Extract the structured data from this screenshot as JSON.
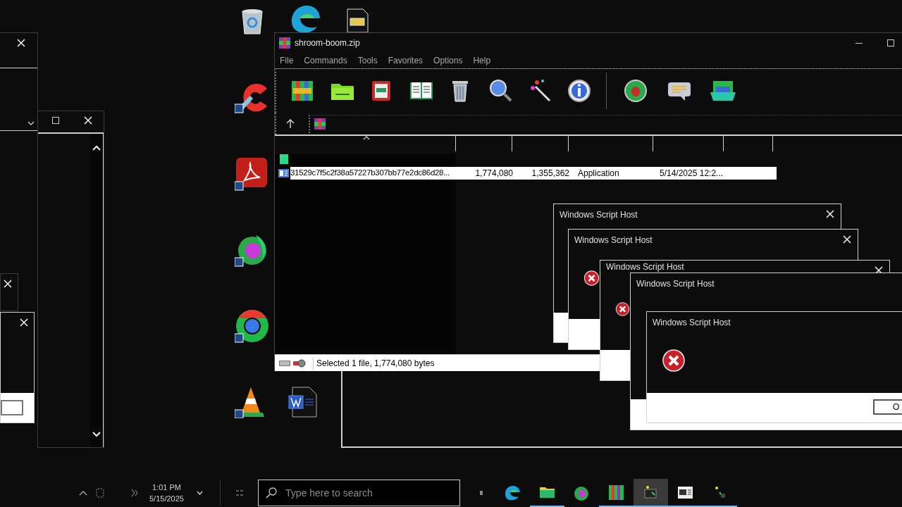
{
  "archive_window": {
    "title": "shroom-boom.zip",
    "menu": [
      "File",
      "Commands",
      "Tools",
      "Favorites",
      "Options",
      "Help"
    ],
    "rows": [
      {
        "name": "31529c7f5c2f38a57227b307bb77e2dc86d28...",
        "size": "1,774,080",
        "packed": "1,355,362",
        "type": "Application",
        "modified": "5/14/2025 12:2...",
        "selected": true
      }
    ],
    "status": "Selected 1 file, 1,774,080 bytes"
  },
  "dialogs": [
    {
      "title": "Windows Script Host"
    },
    {
      "title": "Windows Script Host"
    },
    {
      "title": "Windows Script Host"
    },
    {
      "title": "Windows Script Host"
    },
    {
      "title": "Windows Script Host",
      "button": "O"
    }
  ],
  "taskbar": {
    "time": "1:01 PM",
    "date": "5/15/2025",
    "search": {
      "placeholder": "Type here to search"
    }
  }
}
